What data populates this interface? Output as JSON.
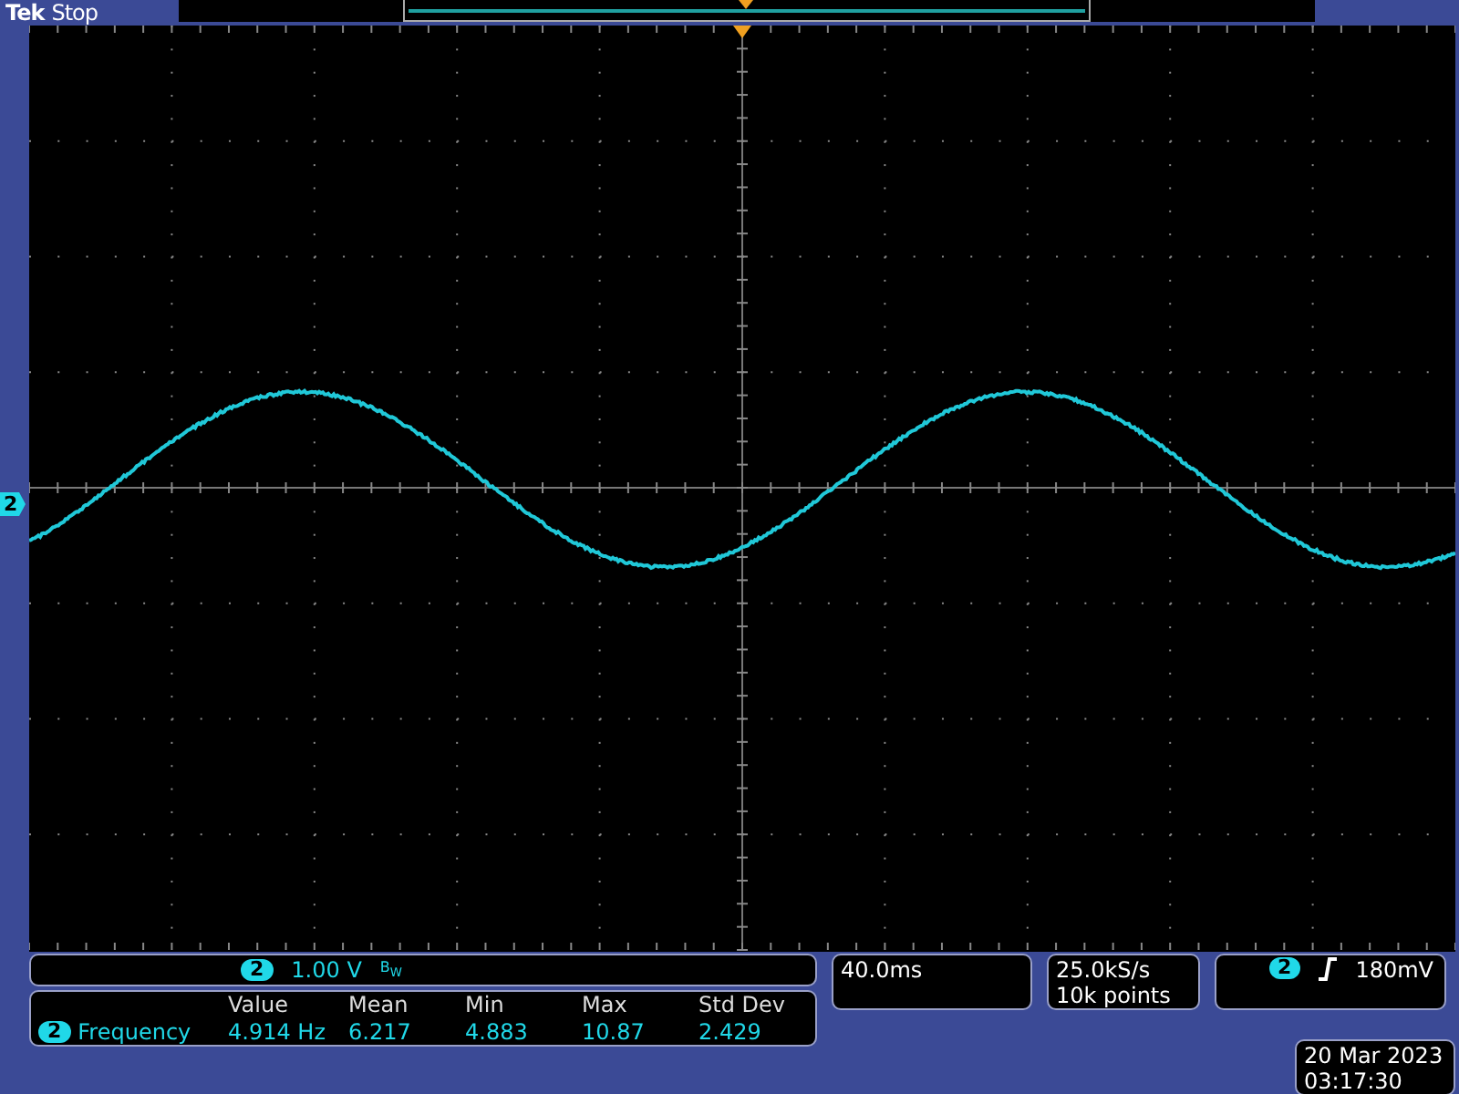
{
  "header": {
    "brand": "Tek",
    "state": "Stop"
  },
  "channel_marker": "2",
  "channel": {
    "number": "2",
    "scale": "1.00 V",
    "bw_indicator": "B$_{W}$"
  },
  "measurements": {
    "columns": [
      "Value",
      "Mean",
      "Min",
      "Max",
      "Std Dev"
    ],
    "rows": [
      {
        "channel": "2",
        "name": "Frequency",
        "values": [
          "4.914 Hz",
          "6.217",
          "4.883",
          "10.87",
          "2.429"
        ]
      }
    ]
  },
  "timebase": "40.0ms",
  "acquisition": {
    "sample_rate": "25.0kS/s",
    "record_length": "10k points"
  },
  "trigger": {
    "channel": "2",
    "rising_slope": true,
    "level": "180mV"
  },
  "clock": {
    "date": "20 Mar  2023",
    "time": "03:17:30"
  }
}
